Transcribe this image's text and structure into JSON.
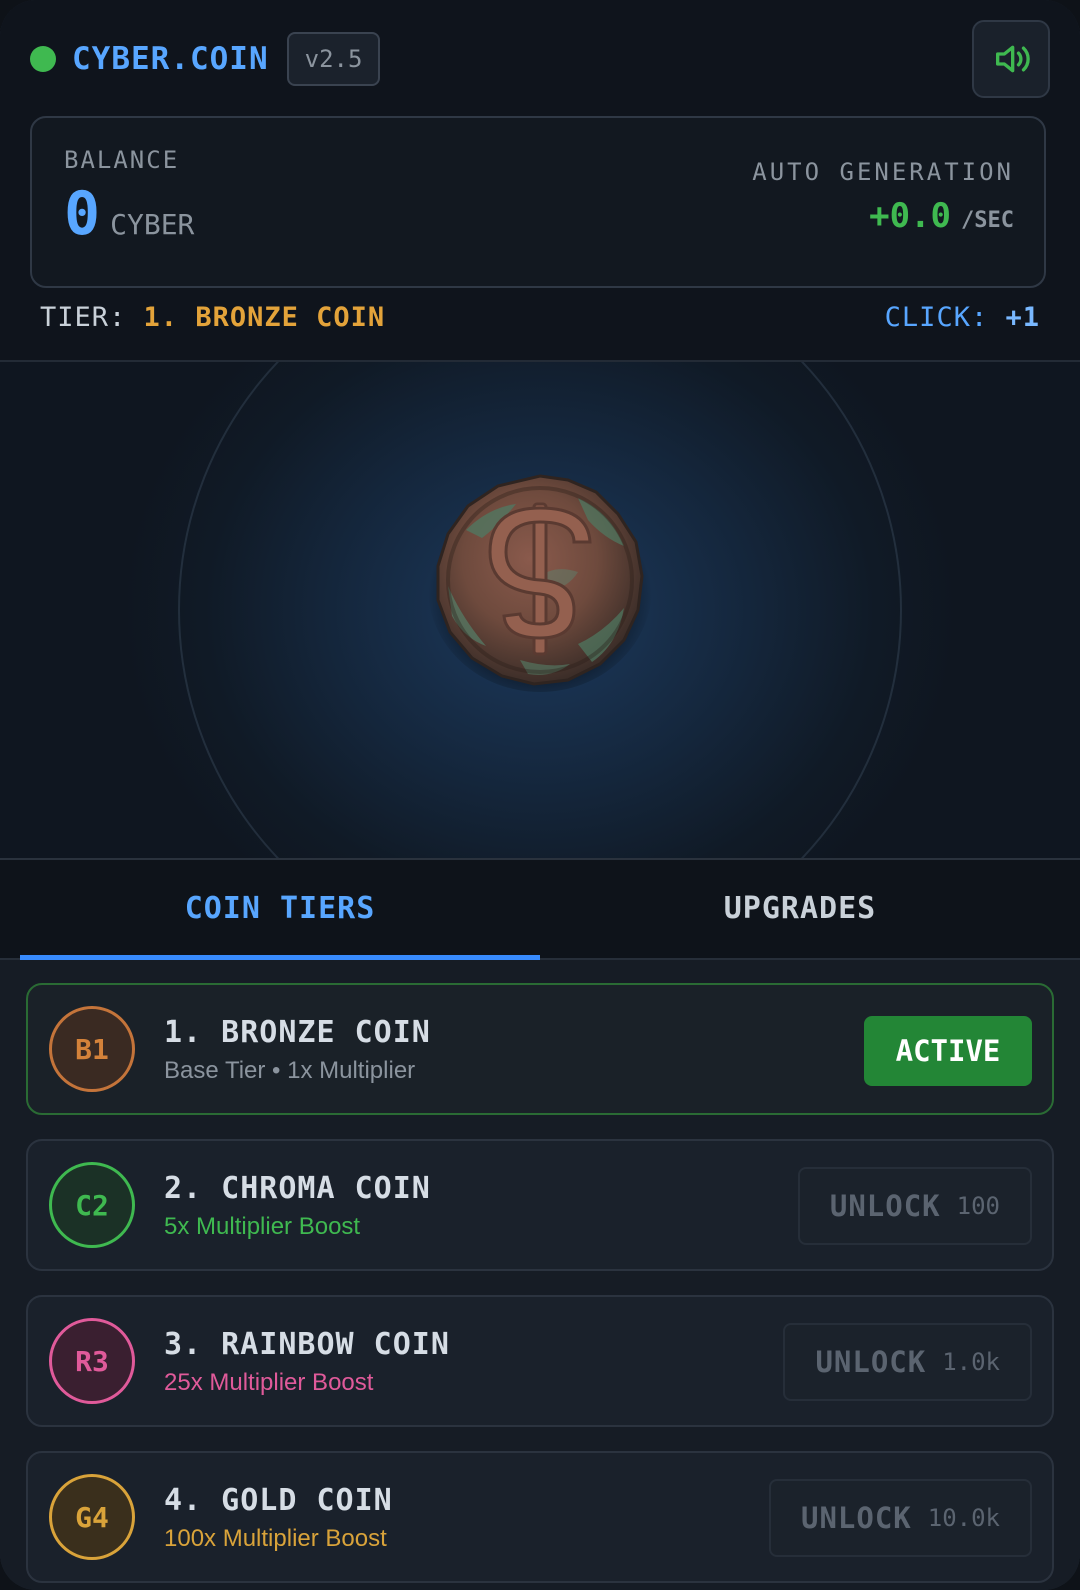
{
  "header": {
    "brand": "CYBER.COIN",
    "version": "v2.5",
    "sound_icon": "speaker-volume-icon"
  },
  "balance": {
    "label": "BALANCE",
    "value": "0",
    "unit": "CYBER",
    "auto_label": "AUTO GENERATION",
    "auto_value": "+0.0",
    "auto_unit": "/SEC"
  },
  "status": {
    "tier_label": "TIER:",
    "tier_name": "1. BRONZE COIN",
    "click_label": "CLICK:",
    "click_value": "+1"
  },
  "coin": {
    "icon": "bronze-dollar-coin-icon"
  },
  "tabs": [
    {
      "label": "COIN TIERS",
      "active": true
    },
    {
      "label": "UPGRADES",
      "active": false
    }
  ],
  "tiers": [
    {
      "badge": "B1",
      "title": "1. BRONZE COIN",
      "subtitle": "Base Tier • 1x Multiplier",
      "button": "ACTIVE",
      "cost": "",
      "color": "#d4823a",
      "subtitle_color": "#8b949e"
    },
    {
      "badge": "C2",
      "title": "2. CHROMA COIN",
      "subtitle": "5x Multiplier Boost",
      "button": "UNLOCK",
      "cost": "100",
      "color": "#3fb950",
      "subtitle_color": "#3fb950"
    },
    {
      "badge": "R3",
      "title": "3. RAINBOW COIN",
      "subtitle": "25x Multiplier Boost",
      "button": "UNLOCK",
      "cost": "1.0k",
      "color": "#e05a9a",
      "subtitle_color": "#e05a9a"
    },
    {
      "badge": "G4",
      "title": "4. GOLD COIN",
      "subtitle": "100x Multiplier Boost",
      "button": "UNLOCK",
      "cost": "10.0k",
      "color": "#d9a33a",
      "subtitle_color": "#d9a33a"
    }
  ],
  "colors": {
    "accent": "#58a6ff",
    "positive": "#3fb950",
    "tier_highlight": "#e3a33a",
    "active_button": "#238636"
  }
}
